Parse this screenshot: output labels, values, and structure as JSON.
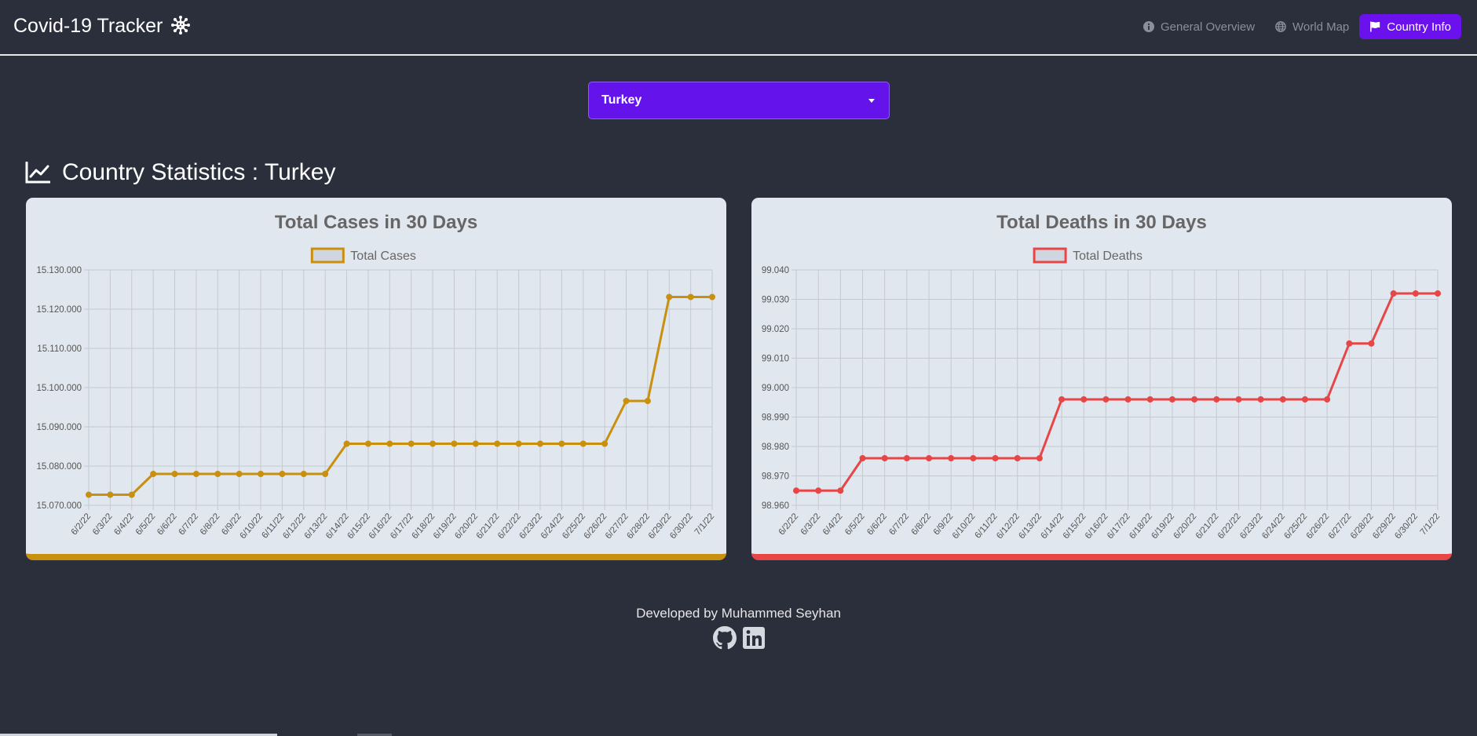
{
  "app": {
    "title": "Covid-19 Tracker",
    "logo_icon": "virus-icon"
  },
  "nav": {
    "items": [
      {
        "label": "General Overview",
        "icon": "info-circle-icon",
        "active": false
      },
      {
        "label": "World Map",
        "icon": "globe-icon",
        "active": false
      },
      {
        "label": "Country Info",
        "icon": "flag-icon",
        "active": true
      }
    ]
  },
  "country_select": {
    "value": "Turkey"
  },
  "section": {
    "title": "Country Statistics : Turkey",
    "icon": "line-chart-icon"
  },
  "colors": {
    "background": "#2a2f3b",
    "accent": "#6a11ee",
    "cases": "#c8900e",
    "deaths": "#e64646",
    "card": "#e1e7ef"
  },
  "chart_data": [
    {
      "type": "line",
      "title": "Total Cases in 30 Days",
      "legend_position": "top-center",
      "grid": true,
      "x": [
        "6/2/22",
        "6/3/22",
        "6/4/22",
        "6/5/22",
        "6/6/22",
        "6/7/22",
        "6/8/22",
        "6/9/22",
        "6/10/22",
        "6/11/22",
        "6/12/22",
        "6/13/22",
        "6/14/22",
        "6/15/22",
        "6/16/22",
        "6/17/22",
        "6/18/22",
        "6/19/22",
        "6/20/22",
        "6/21/22",
        "6/22/22",
        "6/23/22",
        "6/24/22",
        "6/25/22",
        "6/26/22",
        "6/27/22",
        "6/28/22",
        "6/29/22",
        "6/30/22",
        "7/1/22"
      ],
      "ylim": [
        15070000,
        15130000
      ],
      "yticks": [
        "15.130.000",
        "15.120.000",
        "15.110.000",
        "15.100.000",
        "15.090.000",
        "15.080.000",
        "15.070.000"
      ],
      "series": [
        {
          "name": "Total Cases",
          "color": "#c8900e",
          "values": [
            15072700,
            15072700,
            15072700,
            15078000,
            15078000,
            15078000,
            15078000,
            15078000,
            15078000,
            15078000,
            15078000,
            15078000,
            15085700,
            15085700,
            15085700,
            15085700,
            15085700,
            15085700,
            15085700,
            15085700,
            15085700,
            15085700,
            15085700,
            15085700,
            15085700,
            15096600,
            15096600,
            15123100,
            15123100,
            15123100
          ]
        }
      ]
    },
    {
      "type": "line",
      "title": "Total Deaths in 30 Days",
      "legend_position": "top-center",
      "grid": true,
      "x": [
        "6/2/22",
        "6/3/22",
        "6/4/22",
        "6/5/22",
        "6/6/22",
        "6/7/22",
        "6/8/22",
        "6/9/22",
        "6/10/22",
        "6/11/22",
        "6/12/22",
        "6/13/22",
        "6/14/22",
        "6/15/22",
        "6/16/22",
        "6/17/22",
        "6/18/22",
        "6/19/22",
        "6/20/22",
        "6/21/22",
        "6/22/22",
        "6/23/22",
        "6/24/22",
        "6/25/22",
        "6/26/22",
        "6/27/22",
        "6/28/22",
        "6/29/22",
        "6/30/22",
        "7/1/22"
      ],
      "ylim": [
        98960,
        99040
      ],
      "yticks": [
        "99.040",
        "99.030",
        "99.020",
        "99.010",
        "99.000",
        "98.990",
        "98.980",
        "98.970",
        "98.960"
      ],
      "series": [
        {
          "name": "Total Deaths",
          "color": "#e64646",
          "values": [
            98965,
            98965,
            98965,
            98976,
            98976,
            98976,
            98976,
            98976,
            98976,
            98976,
            98976,
            98976,
            98996,
            98996,
            98996,
            98996,
            98996,
            98996,
            98996,
            98996,
            98996,
            98996,
            98996,
            98996,
            98996,
            99015,
            99015,
            99032,
            99032,
            99032
          ]
        }
      ]
    }
  ],
  "footer": {
    "text": "Developed by Muhammed Seyhan",
    "links": [
      {
        "icon": "github-icon"
      },
      {
        "icon": "linkedin-icon"
      }
    ]
  }
}
